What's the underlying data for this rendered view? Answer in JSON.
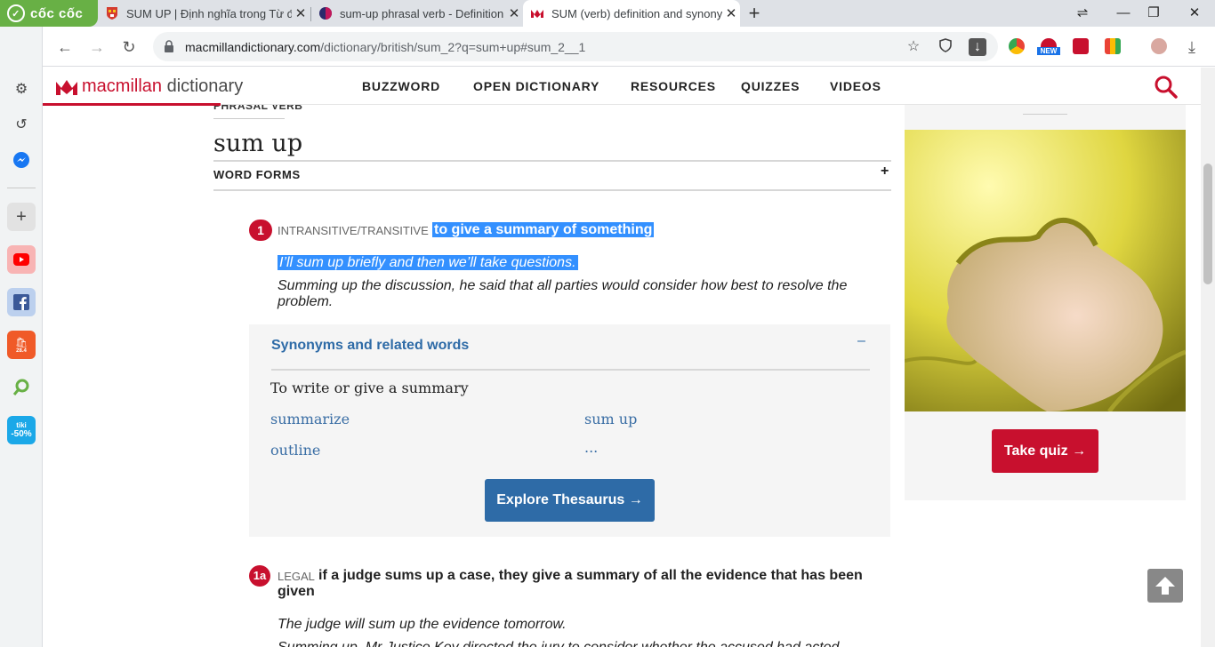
{
  "browser": {
    "brand": "cốc cốc",
    "tabs": [
      {
        "title": "SUM UP | Định nghĩa trong Từ điển",
        "active": false
      },
      {
        "title": "sum-up phrasal verb - Definition",
        "active": false
      },
      {
        "title": "SUM (verb) definition and synonyms",
        "active": true
      }
    ],
    "url_host": "macmillandictionary.com",
    "url_path": "/dictionary/british/sum_2?q=sum+up#sum_2__1",
    "sidebar_badges": {
      "shopee": "28.4",
      "tiki_name": "tiki",
      "tiki": "-50%"
    },
    "ext_badge": "NEW"
  },
  "site": {
    "logo_brand": "macmillan",
    "logo_word": "dictionary",
    "nav": [
      "BUZZWORD",
      "OPEN DICTIONARY",
      "RESOURCES",
      "QUIZZES",
      "VIDEOS"
    ],
    "accent": "#c8102e",
    "link_color": "#2e6ba7"
  },
  "entry": {
    "part_of_speech": "PHRASAL VERB",
    "headword": "sum up",
    "word_forms": "WORD FORMS",
    "word_forms_toggle": "+",
    "sense1": {
      "number": "1",
      "grammar": "INTRANSITIVE/TRANSITIVE",
      "definition": "to give a summary of something",
      "examples": [
        "I’ll sum up briefly and then we’ll take questions.",
        "Summing up the discussion, he said that all parties would consider how best to resolve the problem."
      ]
    },
    "thesaurus": {
      "title": "Synonyms and related words",
      "toggle": "–",
      "subtitle": "To write or give a summary",
      "synonyms": [
        "summarize",
        "sum up",
        "outline",
        "..."
      ],
      "button": "Explore Thesaurus →"
    },
    "sense1a": {
      "number": "1a",
      "grammar": "LEGAL",
      "definition": "if a judge sums up a case, they give a summary of all the evidence that has been given",
      "examples": [
        "The judge will sum up the evidence tomorrow.",
        "Summing up, Mr Justice Key directed the jury to consider whether the accused had acted"
      ]
    }
  },
  "aside": {
    "button": "Take quiz →"
  }
}
